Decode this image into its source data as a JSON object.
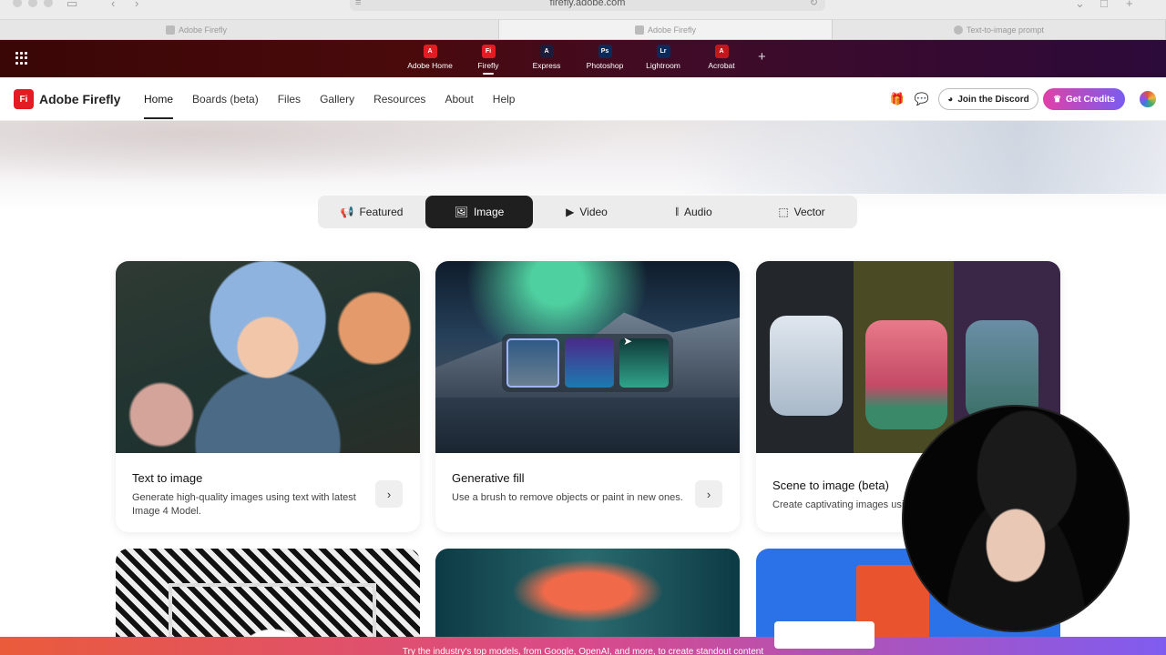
{
  "browser": {
    "url": "firefly.adobe.com",
    "tabs": [
      {
        "title": "Adobe Firefly"
      },
      {
        "title": "Adobe Firefly"
      },
      {
        "title": "Text-to-image prompt"
      }
    ]
  },
  "app_bar": {
    "apps": [
      {
        "label": "Adobe Home",
        "logo": "A",
        "color": "#e31b23"
      },
      {
        "label": "Firefly",
        "logo": "Fi",
        "color": "#e31b23",
        "active": true
      },
      {
        "label": "Express",
        "logo": "A",
        "color": "#1b1b3a"
      },
      {
        "label": "Photoshop",
        "logo": "Ps",
        "color": "#0b2a5a"
      },
      {
        "label": "Lightroom",
        "logo": "Lr",
        "color": "#0b2a5a"
      },
      {
        "label": "Acrobat",
        "logo": "A",
        "color": "#c4161c"
      }
    ]
  },
  "header": {
    "brand": "Adobe Firefly",
    "brand_mark": "Fi",
    "nav": [
      "Home",
      "Boards (beta)",
      "Files",
      "Gallery",
      "Resources",
      "About",
      "Help"
    ],
    "discord_label": "Join the Discord",
    "credits_label": "Get Credits"
  },
  "tabs": [
    {
      "label": "Featured",
      "icon": "megaphone-icon"
    },
    {
      "label": "Image",
      "icon": "image-icon",
      "active": true
    },
    {
      "label": "Video",
      "icon": "play-icon"
    },
    {
      "label": "Audio",
      "icon": "waveform-icon"
    },
    {
      "label": "Vector",
      "icon": "vector-icon"
    }
  ],
  "cards": [
    {
      "title": "Text to image",
      "description": "Generate high-quality images using text with latest Image 4 Model."
    },
    {
      "title": "Generative fill",
      "description": "Use a brush to remove objects or paint in new ones."
    },
    {
      "title": "Scene to image (beta)",
      "description": "Create captivating images usi"
    }
  ],
  "banner": {
    "text": "Try the industry's top models, from Google, OpenAI, and more, to create standout content"
  }
}
